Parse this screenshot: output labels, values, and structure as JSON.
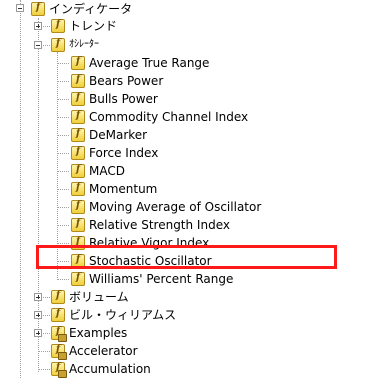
{
  "tree": {
    "root": {
      "label": "インディケータ",
      "icon": "function-folder-icon",
      "expanded": true
    },
    "trend": {
      "label": "トレンド",
      "icon": "function-folder-icon",
      "expanded": false
    },
    "oscillators": {
      "label": "ｵｼﾚｰﾀｰ",
      "icon": "function-folder-icon",
      "expanded": true,
      "items": [
        {
          "label": "Average True Range",
          "icon": "function-icon"
        },
        {
          "label": "Bears Power",
          "icon": "function-icon"
        },
        {
          "label": "Bulls Power",
          "icon": "function-icon"
        },
        {
          "label": "Commodity Channel Index",
          "icon": "function-icon"
        },
        {
          "label": "DeMarker",
          "icon": "function-icon"
        },
        {
          "label": "Force Index",
          "icon": "function-icon"
        },
        {
          "label": "MACD",
          "icon": "function-icon"
        },
        {
          "label": "Momentum",
          "icon": "function-icon"
        },
        {
          "label": "Moving Average of Oscillator",
          "icon": "function-icon"
        },
        {
          "label": "Relative Strength Index",
          "icon": "function-icon"
        },
        {
          "label": "Relative Vigor Index",
          "icon": "function-icon"
        },
        {
          "label": "Stochastic Oscillator",
          "icon": "function-icon",
          "highlighted": true
        },
        {
          "label": "Williams' Percent Range",
          "icon": "function-icon"
        }
      ]
    },
    "volumes": {
      "label": "ボリューム",
      "icon": "function-folder-icon",
      "expanded": false
    },
    "bill_williams": {
      "label": "ビル・ウィリアムス",
      "icon": "function-folder-icon",
      "expanded": false
    },
    "examples": {
      "label": "Examples",
      "icon": "function-locked-icon",
      "expanded": false
    },
    "custom": [
      {
        "label": "Accelerator",
        "icon": "function-locked-icon"
      },
      {
        "label": "Accumulation",
        "icon": "function-locked-icon"
      }
    ]
  },
  "colors": {
    "highlight_border": "#ff1a1a",
    "icon_fill": "#f0cf3a"
  }
}
